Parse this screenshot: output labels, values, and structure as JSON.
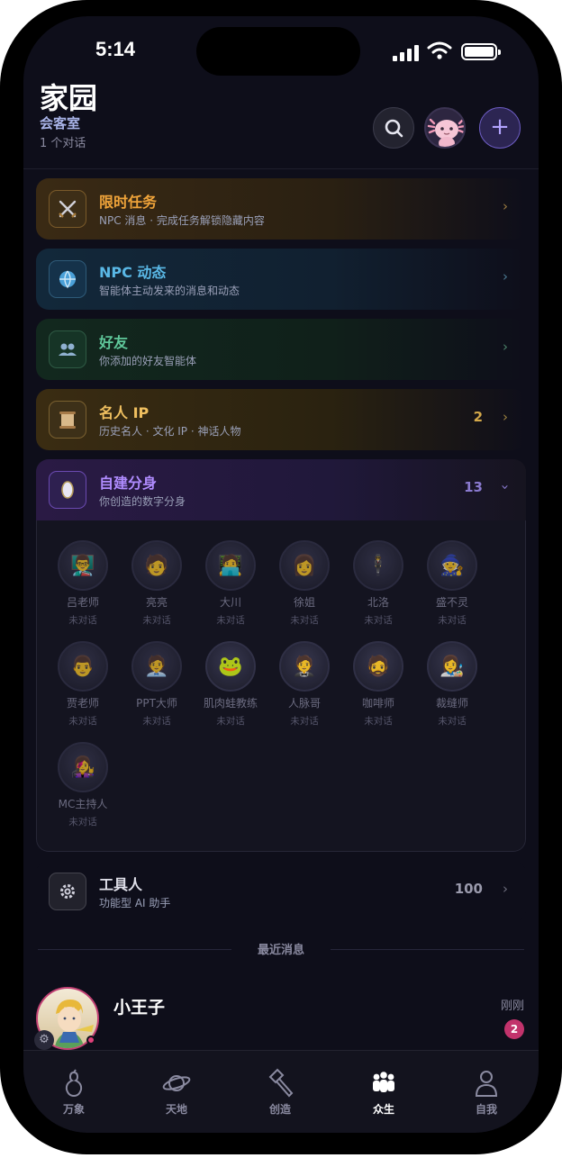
{
  "status": {
    "time": "5:14"
  },
  "header": {
    "title": "家园",
    "subtitle": "会客室",
    "conversation_count": "1 个对话"
  },
  "categories": [
    {
      "name": "限时任务",
      "desc": "NPC 消息 · 完成任务解锁隐藏内容",
      "count": "",
      "icon": "crossed-swords-icon",
      "accent": "#f0a43a"
    },
    {
      "name": "NPC 动态",
      "desc": "智能体主动发来的消息和动态",
      "count": "",
      "icon": "globe-icon",
      "accent": "#5ab8e6"
    },
    {
      "name": "好友",
      "desc": "你添加的好友智能体",
      "count": "",
      "icon": "people-icon",
      "accent": "#5fc79a"
    },
    {
      "name": "名人 IP",
      "desc": "历史名人 · 文化 IP · 神话人物",
      "count": "2",
      "icon": "scroll-icon",
      "accent": "#f0c060"
    },
    {
      "name": "自建分身",
      "desc": "你创造的数字分身",
      "count": "13",
      "icon": "mirror-icon",
      "accent": "#b08cff"
    },
    {
      "name": "工具人",
      "desc": "功能型 AI 助手",
      "count": "100",
      "icon": "gear-icon",
      "accent": "#d0d0dc"
    }
  ],
  "avatars": [
    {
      "name": "吕老师",
      "status": "未对话"
    },
    {
      "name": "亮亮",
      "status": "未对话"
    },
    {
      "name": "大川",
      "status": "未对话"
    },
    {
      "name": "徐姐",
      "status": "未对话"
    },
    {
      "name": "北洛",
      "status": "未对话"
    },
    {
      "name": "盛不灵",
      "status": "未对话"
    },
    {
      "name": "贾老师",
      "status": "未对话"
    },
    {
      "name": "PPT大师",
      "status": "未对话"
    },
    {
      "name": "肌肉蛙教练",
      "status": "未对话"
    },
    {
      "name": "人脉哥",
      "status": "未对话"
    },
    {
      "name": "咖啡师",
      "status": "未对话"
    },
    {
      "name": "裁缝师",
      "status": "未对话"
    },
    {
      "name": "MC主持人",
      "status": "未对话"
    }
  ],
  "recent": {
    "label": "最近消息",
    "items": [
      {
        "name": "小王子",
        "time": "刚刚",
        "unread": "2"
      }
    ]
  },
  "tabs": [
    {
      "label": "万象",
      "icon": "gourd-icon"
    },
    {
      "label": "天地",
      "icon": "planet-icon"
    },
    {
      "label": "创造",
      "icon": "hammer-icon"
    },
    {
      "label": "众生",
      "icon": "crowd-icon",
      "active": true
    },
    {
      "label": "自我",
      "icon": "user-icon"
    }
  ]
}
